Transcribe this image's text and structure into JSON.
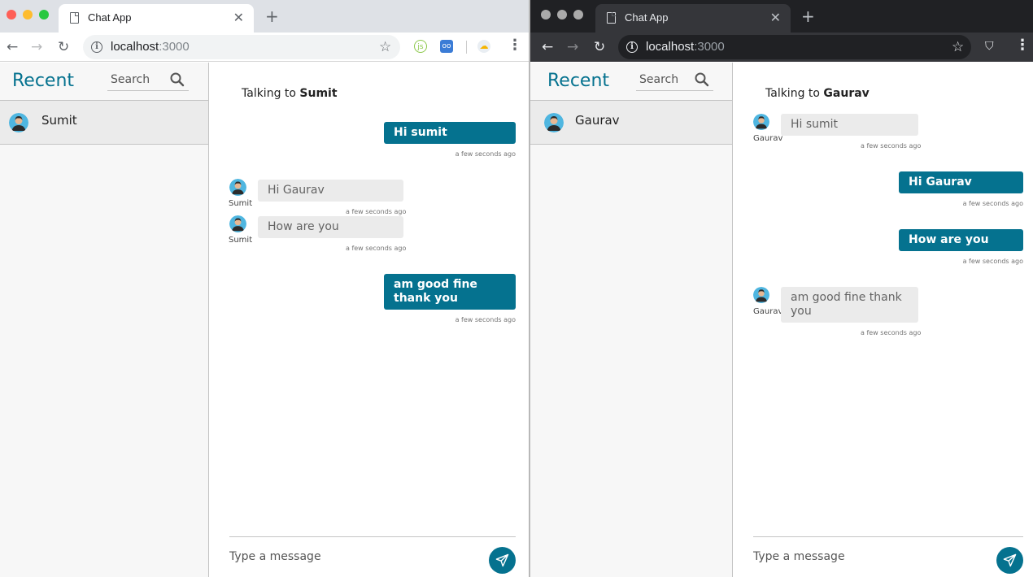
{
  "browser_left": {
    "theme": "light",
    "tab_title": "Chat App",
    "url_host": "localhost",
    "url_port": ":3000"
  },
  "browser_right": {
    "theme": "dark",
    "tab_title": "Chat App",
    "url_host": "localhost",
    "url_port": ":3000"
  },
  "colors": {
    "accent": "#05728f",
    "incoming_bg": "#ebebeb",
    "sidebar_bg": "#f7f7f7"
  },
  "left": {
    "sidebar": {
      "title": "Recent",
      "search_placeholder": "Search",
      "contact_name": "Sumit"
    },
    "talking_prefix": "Talking to",
    "talking_name": "Sumit",
    "messages": [
      {
        "direction": "out",
        "text": "Hi sumit",
        "time": "a few seconds ago"
      },
      {
        "direction": "in",
        "sender": "Sumit",
        "text": "Hi Gaurav",
        "time": "a few seconds ago"
      },
      {
        "direction": "in",
        "sender": "Sumit",
        "text": "How are you",
        "time": "a few seconds ago"
      },
      {
        "direction": "out",
        "text": "am good fine thank you",
        "time": "a few seconds ago"
      }
    ],
    "composer_placeholder": "Type a message"
  },
  "right": {
    "sidebar": {
      "title": "Recent",
      "search_placeholder": "Search",
      "contact_name": "Gaurav"
    },
    "talking_prefix": "Talking to",
    "talking_name": "Gaurav",
    "messages": [
      {
        "direction": "in",
        "sender": "Gaurav",
        "text": "Hi sumit",
        "time": "a few seconds ago"
      },
      {
        "direction": "out",
        "text": "Hi Gaurav",
        "time": "a few seconds ago"
      },
      {
        "direction": "out",
        "text": "How are you",
        "time": "a few seconds ago"
      },
      {
        "direction": "in",
        "sender": "Gaurav",
        "text": "am good fine thank you",
        "time": "a few seconds ago"
      }
    ],
    "composer_placeholder": "Type a message"
  }
}
